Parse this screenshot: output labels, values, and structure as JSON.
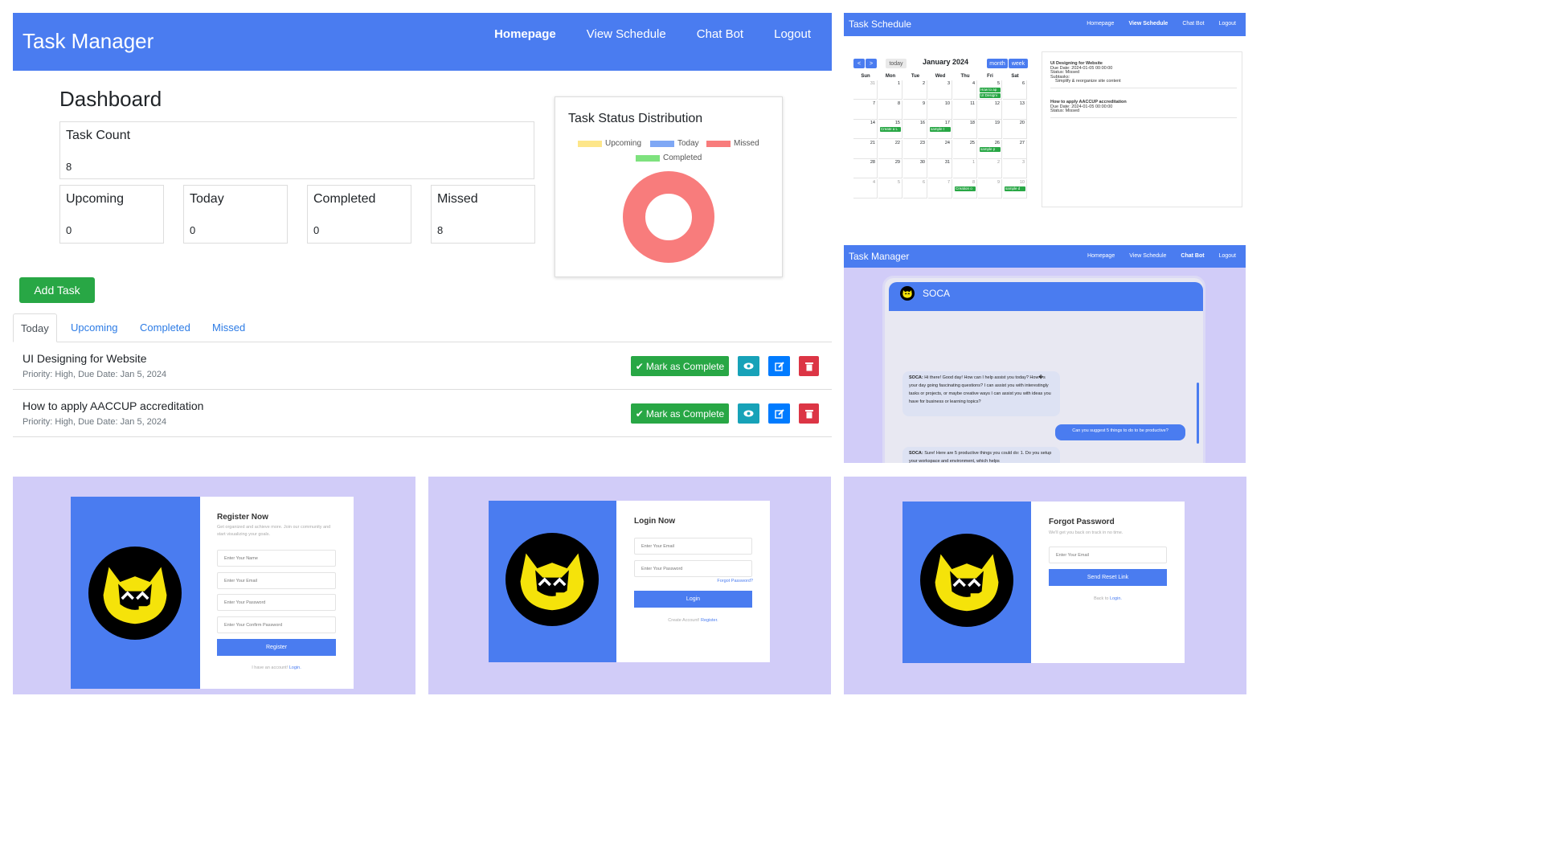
{
  "dashboard": {
    "brand": "Task Manager",
    "nav": [
      "Homepage",
      "View Schedule",
      "Chat Bot",
      "Logout"
    ],
    "title": "Dashboard",
    "task_count": {
      "label": "Task Count",
      "value": "8"
    },
    "stats": [
      {
        "label": "Upcoming",
        "value": "0"
      },
      {
        "label": "Today",
        "value": "0"
      },
      {
        "label": "Completed",
        "value": "0"
      },
      {
        "label": "Missed",
        "value": "8"
      }
    ],
    "add_task": "Add Task",
    "tabs": [
      "Today",
      "Upcoming",
      "Completed",
      "Missed"
    ],
    "tasks": [
      {
        "title": "UI Designing for Website",
        "meta": "Priority: High, Due Date: Jan 5, 2024"
      },
      {
        "title": "How to apply AACCUP accreditation",
        "meta": "Priority: High, Due Date: Jan 5, 2024"
      }
    ],
    "mark_complete": "Mark as Complete"
  },
  "chart_data": {
    "type": "pie",
    "title": "Task Status Distribution",
    "categories": [
      "Upcoming",
      "Today",
      "Missed",
      "Completed"
    ],
    "values": [
      0,
      0,
      8,
      0
    ],
    "colors": [
      "#fde68a",
      "#7fa8f5",
      "#f87c7c",
      "#7ee27e"
    ],
    "donut": true,
    "legend": "top"
  },
  "schedule": {
    "brand": "Task Schedule",
    "nav": [
      "Homepage",
      "View Schedule",
      "Chat Bot",
      "Logout"
    ],
    "month": "January 2024",
    "today_btn": "today",
    "month_btn": "month",
    "week_btn": "week",
    "prev": "<",
    "next": ">",
    "weekdays": [
      "Sun",
      "Mon",
      "Tue",
      "Wed",
      "Thu",
      "Fri",
      "Sat"
    ],
    "weeks": [
      [
        "31",
        "1",
        "2",
        "3",
        "4",
        "5",
        "6"
      ],
      [
        "7",
        "8",
        "9",
        "10",
        "11",
        "12",
        "13"
      ],
      [
        "14",
        "15",
        "16",
        "17",
        "18",
        "19",
        "20"
      ],
      [
        "21",
        "22",
        "23",
        "24",
        "25",
        "26",
        "27"
      ],
      [
        "28",
        "29",
        "30",
        "31",
        "1",
        "2",
        "3"
      ],
      [
        "4",
        "5",
        "6",
        "7",
        "8",
        "9",
        "10"
      ]
    ],
    "events": [
      "How to ap",
      "UI Designi",
      "Create a L",
      "sample t",
      "sample p",
      "Creation o",
      "sample d"
    ],
    "details": [
      {
        "title": "UI Designing for Website",
        "due": "Due Date: 2024-01-05 00:00:00",
        "status": "Status: Missed",
        "subtasks": "Subtasks:",
        "sub": "Simplify & reorganize site content"
      },
      {
        "title": "How to apply AACCUP accreditation",
        "due": "Due Date: 2024-01-05 00:00:00",
        "status": "Status: Missed"
      }
    ]
  },
  "chatbot": {
    "brand": "Task Manager",
    "nav": [
      "Homepage",
      "View Schedule",
      "Chat Bot",
      "Logout"
    ],
    "bot_name": "SOCA",
    "messages": [
      {
        "from": "bot",
        "prefix": "SOCA:",
        "text": " Hi there! Good day! How can I help assist you today? How�s your day going fascinating questions? I can assist you with interestingly tasks or projects, or maybe creative ways I can assist you with ideas you have for business or learning topics?"
      },
      {
        "from": "user",
        "text": "Can you suggest 5 things to do to be productive?"
      },
      {
        "from": "bot",
        "prefix": "SOCA:",
        "text": " Sure! Here are 5 productive things you could do: 1. Do you setup your workspace and environment, which helps"
      }
    ]
  },
  "register": {
    "title": "Register Now",
    "subtitle": "Get organized and achieve more. Join our community and start visualizing your goals.",
    "placeholders": [
      "Enter Your Name",
      "Enter Your Email",
      "Enter Your Password",
      "Enter Your Confirm Password"
    ],
    "button": "Register",
    "footer": "I have an account!",
    "footer_link": "Login."
  },
  "login": {
    "title": "Login Now",
    "placeholders": [
      "Enter Your Email",
      "Enter Your Password"
    ],
    "forgot": "Forgot Password?",
    "button": "Login",
    "footer": "Create Account!",
    "footer_link": "Register."
  },
  "forgot": {
    "title": "Forgot Password",
    "subtitle": "We'll get you back on track in no time.",
    "placeholder": "Enter Your Email",
    "button": "Send Reset Link",
    "footer": "Back to",
    "footer_link": "Login."
  }
}
